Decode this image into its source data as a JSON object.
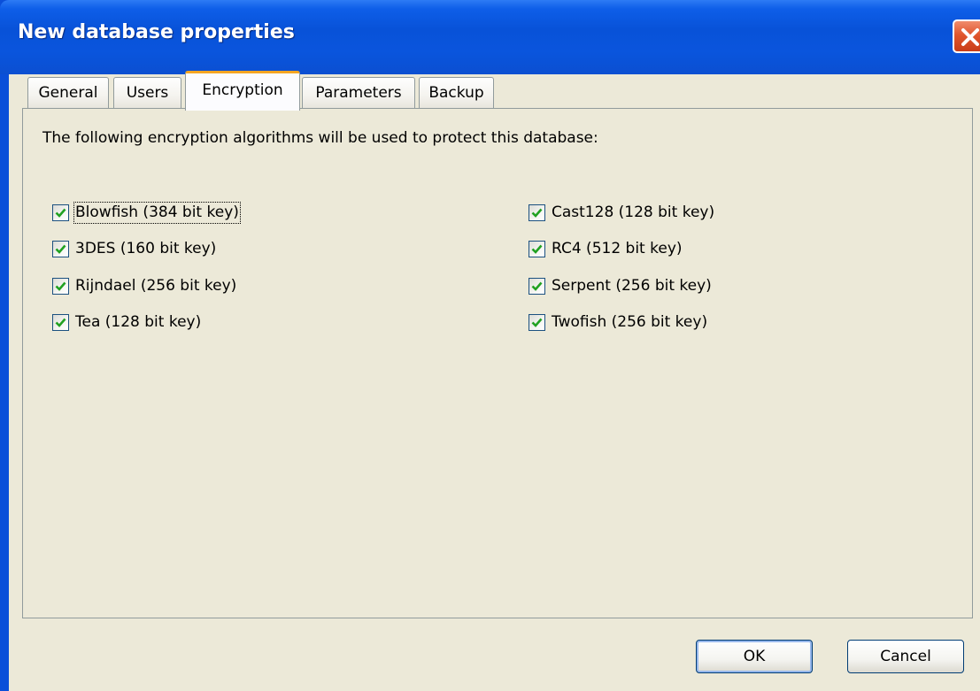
{
  "window": {
    "title": "New database properties",
    "close_icon": "close-icon"
  },
  "tabs": [
    {
      "label": "General",
      "active": false
    },
    {
      "label": "Users",
      "active": false
    },
    {
      "label": "Encryption",
      "active": true
    },
    {
      "label": "Parameters",
      "active": false
    },
    {
      "label": "Backup",
      "active": false
    }
  ],
  "encryption": {
    "intro": "The following encryption algorithms will be used to protect this database:",
    "left_algorithms": [
      {
        "label": "Blowfish (384 bit key)",
        "checked": true
      },
      {
        "label": "3DES (160 bit key)",
        "checked": true
      },
      {
        "label": "Rijndael (256 bit key)",
        "checked": true
      },
      {
        "label": "Tea (128 bit key)",
        "checked": true
      }
    ],
    "right_algorithms": [
      {
        "label": "Cast128 (128 bit key)",
        "checked": true
      },
      {
        "label": "RC4 (512 bit key)",
        "checked": true
      },
      {
        "label": "Serpent (256 bit key)",
        "checked": true
      },
      {
        "label": "Twofish (256 bit key)",
        "checked": true
      }
    ]
  },
  "buttons": {
    "ok": "OK",
    "cancel": "Cancel"
  },
  "colors": {
    "titlebar": "#0a55dd",
    "dialog_bg": "#ece9d8",
    "active_tab_accent": "#f5a623",
    "check_mark": "#21a121",
    "close_button": "#e0562e"
  }
}
